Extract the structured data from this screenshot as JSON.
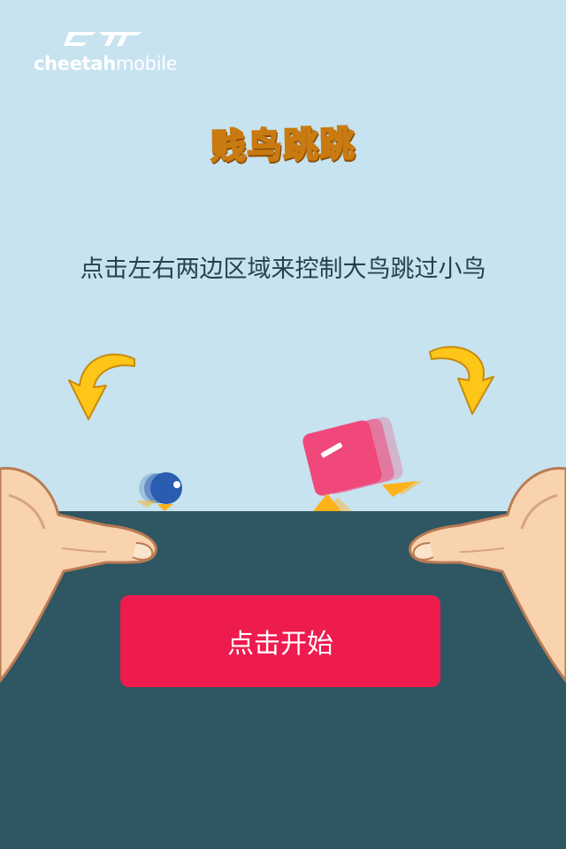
{
  "brand": {
    "logo_text_bold": "cheetah",
    "logo_text_light": "mobile",
    "logo_color": "#ffffff"
  },
  "game": {
    "title": "贱鸟跳跳",
    "instruction": "点击左右两边区域来控制大鸟跳过小鸟",
    "start_label": "点击开始"
  },
  "colors": {
    "sky": "#c6e3ef",
    "ground": "#2e5663",
    "title_fill": "#ffd21a",
    "title_outline": "#c97a10",
    "instruction_text": "#27414d",
    "button_bg": "#ee1b4e",
    "button_text": "#ffffff",
    "arrow": "#ffc61a",
    "small_bird": "#2a5cb0",
    "big_bird": "#f0487a",
    "bird_feet": "#ffb21a",
    "hand_skin": "#f8d3ad",
    "hand_outline": "#b97a54"
  },
  "icons": {
    "logo": "cheetah-mobile-logo",
    "left_arrow": "curved-arrow-down-icon",
    "right_arrow": "curved-arrow-down-icon",
    "small_bird": "small-blue-bird",
    "big_bird": "big-pink-bird",
    "left_hand": "left-hand-icon",
    "right_hand": "right-hand-icon"
  }
}
